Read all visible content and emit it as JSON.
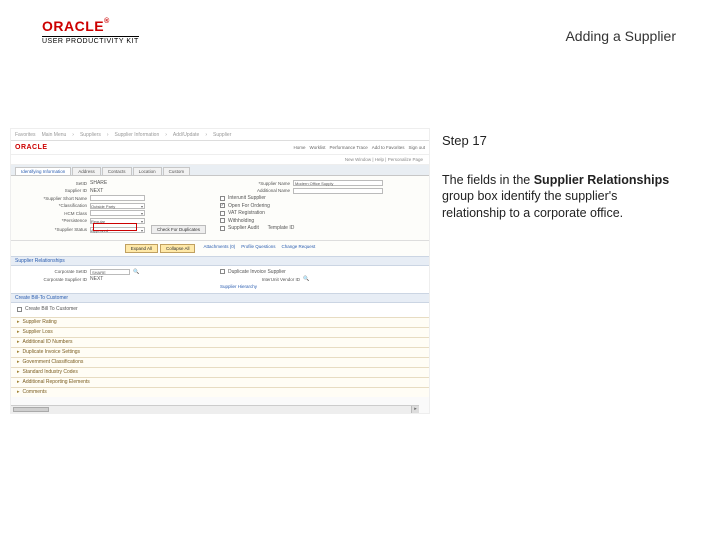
{
  "header": {
    "logo_text": "ORACLE",
    "logo_tm": "®",
    "upk_text": "USER PRODUCTIVITY KIT",
    "title": "Adding a Supplier"
  },
  "instruction": {
    "step_label": "Step 17",
    "text_pre": "The fields in the ",
    "text_bold": "Supplier Relationships",
    "text_post": " group box identify the supplier's relationship to a corporate office."
  },
  "shot": {
    "topbar": {
      "item1": "Favorites",
      "item2": "Main Menu",
      "item3": "Suppliers",
      "item4": "Supplier Information",
      "item5": "Add/Update",
      "item6": "Supplier"
    },
    "oracle": "ORACLE",
    "nav": {
      "l1": "Home",
      "l2": "Worklist",
      "l3": "Performance Trace",
      "l4": "Add to Favorites",
      "l5": "Sign out"
    },
    "breadcrumb": "New Window | Help | Personalize Page",
    "tabs": {
      "t1": "Identifying Information",
      "t2": "Address",
      "t3": "Contacts",
      "t4": "Location",
      "t5": "Custom"
    },
    "form": {
      "setid_label": "SetID",
      "setid_value": "SHARE",
      "suppid_label": "Supplier ID",
      "suppid_value": "NEXT",
      "suppshort_label": "*Supplier Short Name",
      "suppshort_value": "",
      "suppname_label": "*Supplier Name",
      "suppname_value": "Modern Office Supply",
      "addlname_label": "Additional Name",
      "addlname_value": "",
      "class_label": "*Classification",
      "class_value": "Outside Party",
      "hcm_label": "HCM Class",
      "hcm_value": "",
      "persist_label": "*Persistence",
      "persist_value": "Regular",
      "status_label": "*Supplier Status",
      "status_value": "Approved",
      "cb_interunit": "Interunit Supplier",
      "cb_openorder": "Open For Ordering",
      "cb_vat": "VAT Registration",
      "cb_wh": "Withholding",
      "cb_supaudit": "Supplier Audit",
      "template_label": "Template ID",
      "btn_expand": "Expand All",
      "btn_collapse": "Collapse All",
      "lnk_attach": "Attachments (0)",
      "lnk_profileq": "Profile Questions",
      "lnk_changereq": "Change Request",
      "btn_check_dup": "Check For Duplicates"
    },
    "sections": {
      "rel_hdr": "Supplier Relationships",
      "rel_corp_label": "Corporate SetID",
      "rel_corp_value": "SHARE",
      "rel_dup_cb": "Duplicate Invoice Supplier",
      "rel_corpsup_label": "Corporate Supplier ID",
      "rel_corpsup_value": "NEXT",
      "rel_invfrom_label": "InterUnit Supplier",
      "rel_intervnd_label": "InterUnit Vendor ID",
      "rel_hier_label": "Supplier Hierarchy",
      "link_hdr": "Create Bill-To Customer",
      "link_cb": "Create Bill To Customer",
      "exp1": "Supplier Rating",
      "exp2": "Supplier Loss",
      "exp3": "Additional ID Numbers",
      "exp4": "Duplicate Invoice Settings",
      "exp5": "Government Classifications",
      "exp6": "Standard Industry Codes",
      "exp7": "Additional Reporting Elements",
      "exp8": "Comments"
    }
  }
}
